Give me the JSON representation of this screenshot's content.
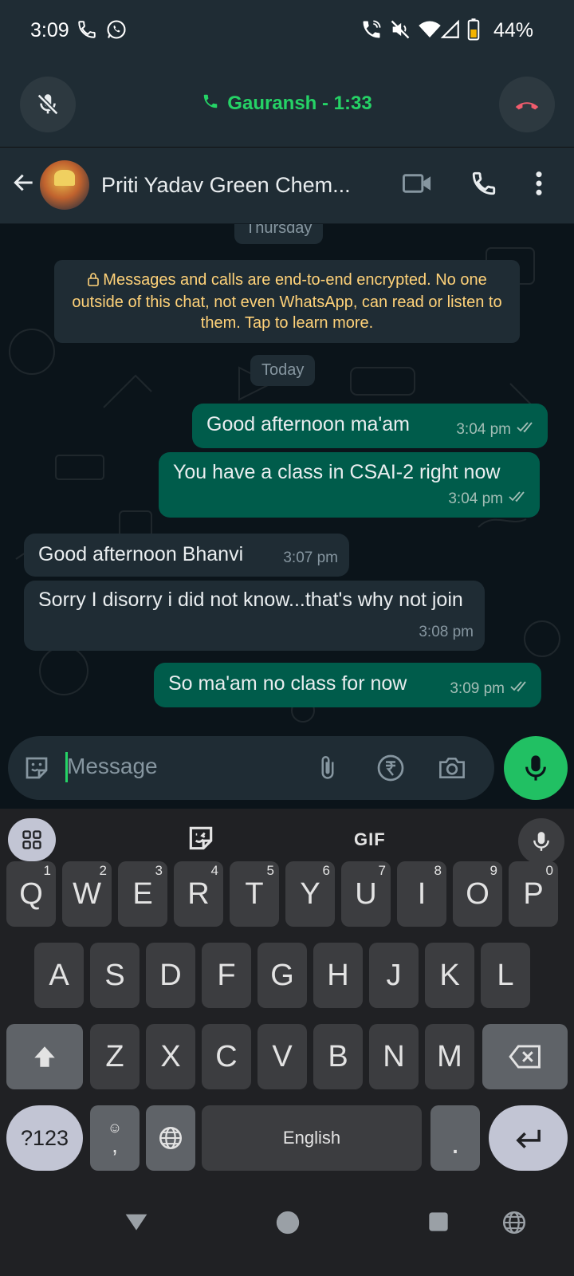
{
  "status_bar": {
    "time": "3:09",
    "battery": "44%"
  },
  "call_banner": {
    "title": "Gauransh - 1:33"
  },
  "header": {
    "contact_name": "Priti Yadav Green Chem..."
  },
  "chat": {
    "prev_day_label": "Thursday",
    "encryption_notice": "Messages and calls are end-to-end encrypted. No one outside of this chat, not even WhatsApp, can read or listen to them. Tap to learn more.",
    "today_label": "Today",
    "messages": [
      {
        "direction": "out",
        "text": "Good afternoon ma'am",
        "time": "3:04 pm"
      },
      {
        "direction": "out",
        "text": "You have a class in CSAI-2 right now",
        "time": "3:04 pm"
      },
      {
        "direction": "in",
        "text": "Good afternoon Bhanvi",
        "time": "3:07 pm"
      },
      {
        "direction": "in",
        "text": "Sorry I disorry i did not know...that's why not join",
        "time": "3:08 pm"
      },
      {
        "direction": "out",
        "text": "So ma'am no class for now",
        "time": "3:09 pm"
      }
    ]
  },
  "input": {
    "placeholder": "Message"
  },
  "keyboard": {
    "gif_label": "GIF",
    "row1": [
      {
        "k": "Q",
        "h": "1"
      },
      {
        "k": "W",
        "h": "2"
      },
      {
        "k": "E",
        "h": "3"
      },
      {
        "k": "R",
        "h": "4"
      },
      {
        "k": "T",
        "h": "5"
      },
      {
        "k": "Y",
        "h": "6"
      },
      {
        "k": "U",
        "h": "7"
      },
      {
        "k": "I",
        "h": "8"
      },
      {
        "k": "O",
        "h": "9"
      },
      {
        "k": "P",
        "h": "0"
      }
    ],
    "row2": [
      "A",
      "S",
      "D",
      "F",
      "G",
      "H",
      "J",
      "K",
      "L"
    ],
    "row3": [
      "Z",
      "X",
      "C",
      "V",
      "B",
      "N",
      "M"
    ],
    "symbols_label": "?123",
    "comma": ",",
    "space_label": "English",
    "period": "."
  },
  "colors": {
    "accent": "#25d366",
    "outgoing_bubble": "#005c4b",
    "incoming_bubble": "#1f2c34",
    "notice_text": "#ffd279"
  }
}
